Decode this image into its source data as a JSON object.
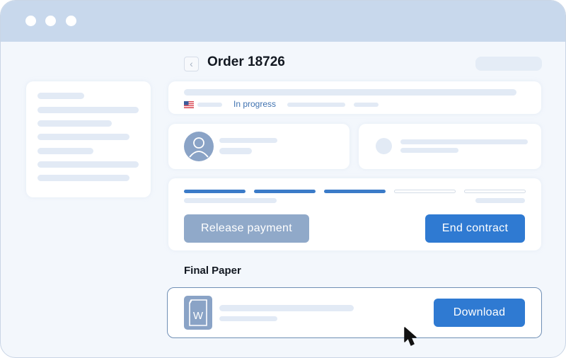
{
  "window": {
    "title_bar_dots": 3
  },
  "header": {
    "back_icon": "chevron-left-icon",
    "back_glyph": "‹",
    "title": "Order 18726"
  },
  "order_status": {
    "flag_icon": "us-flag-icon",
    "status": "In progress"
  },
  "progress": {
    "steps_total": 5,
    "steps_completed": 3
  },
  "actions": {
    "release_payment_label": "Release payment",
    "end_contract_label": "End contract"
  },
  "final_paper": {
    "section_title": "Final Paper",
    "file_icon": "word-document-icon",
    "file_icon_letter": "W",
    "download_label": "Download"
  },
  "colors": {
    "accent": "#2f7ad2",
    "disabled_button": "#90a9c9",
    "status_text": "#3f72b0",
    "titlebar": "#c8d8ec"
  }
}
